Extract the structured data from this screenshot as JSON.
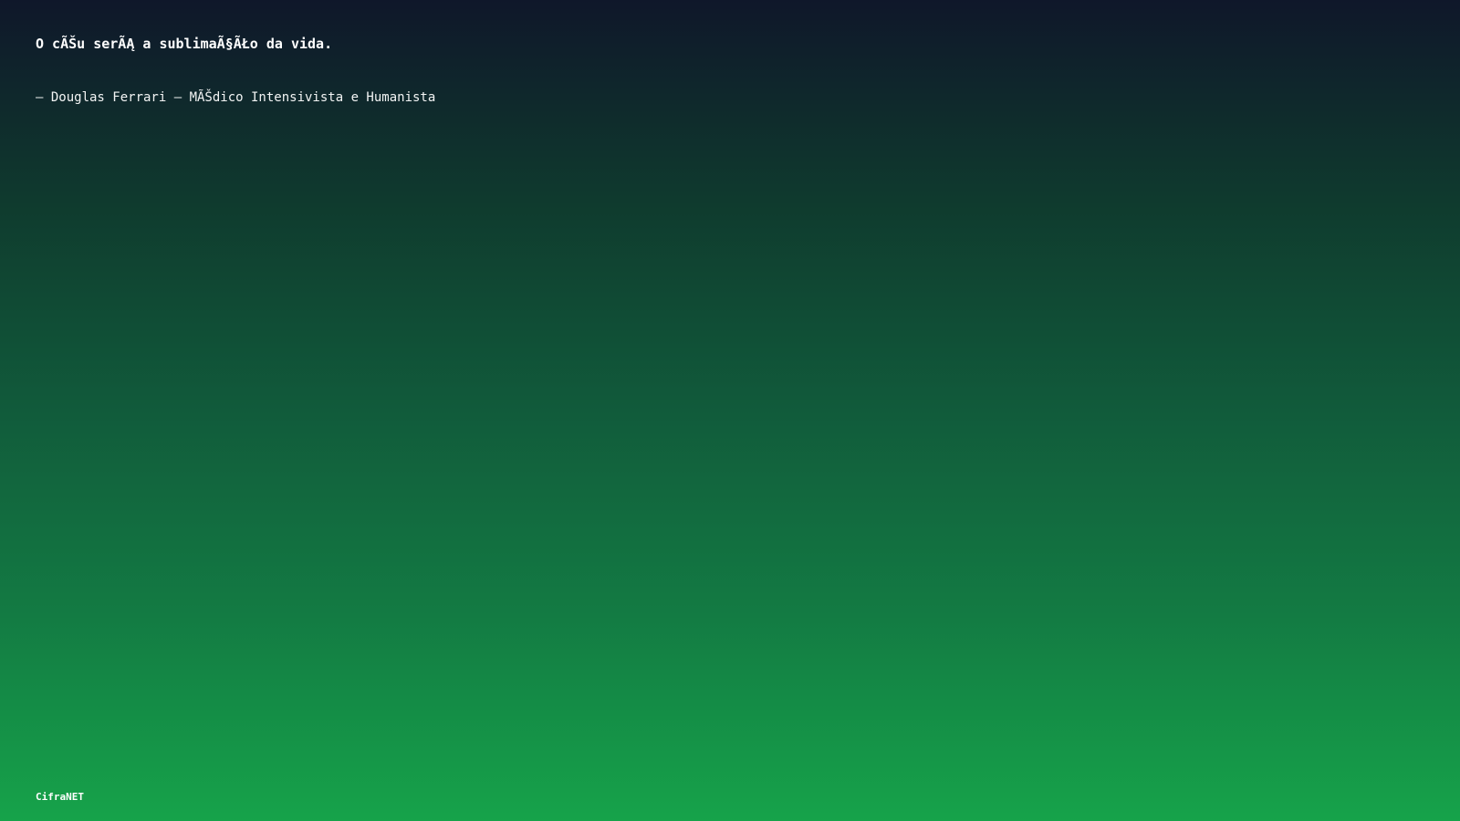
{
  "quote": {
    "text": "O cÃŠu serÃĄ a sublimaÃ§ÃŁo da vida.",
    "author": "– Douglas Ferrari – MÃŠdico Intensivista e Humanista"
  },
  "footer": {
    "brand": "CifraNET"
  },
  "colors": {
    "gradient_top": "#0f172a",
    "gradient_bottom": "#16a34a",
    "text": "#ffffff"
  }
}
